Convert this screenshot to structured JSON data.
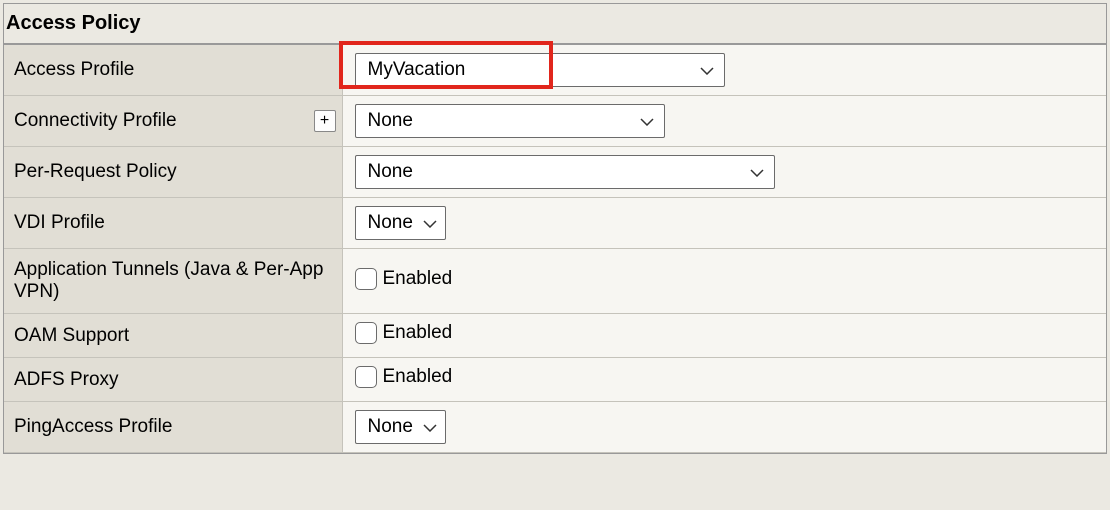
{
  "section_title": "Access Policy",
  "rows": {
    "access_profile": {
      "label": "Access Profile",
      "value": "MyVacation"
    },
    "connectivity_profile": {
      "label": "Connectivity Profile",
      "value": "None",
      "plus_label": "+"
    },
    "per_request_policy": {
      "label": "Per-Request Policy",
      "value": "None"
    },
    "vdi_profile": {
      "label": "VDI Profile",
      "value": "None"
    },
    "app_tunnels": {
      "label": "Application Tunnels (Java & Per-App VPN)",
      "checkbox_label": "Enabled"
    },
    "oam_support": {
      "label": "OAM Support",
      "checkbox_label": "Enabled"
    },
    "adfs_proxy": {
      "label": "ADFS Proxy",
      "checkbox_label": "Enabled"
    },
    "pingaccess_profile": {
      "label": "PingAccess Profile",
      "value": "None"
    }
  }
}
